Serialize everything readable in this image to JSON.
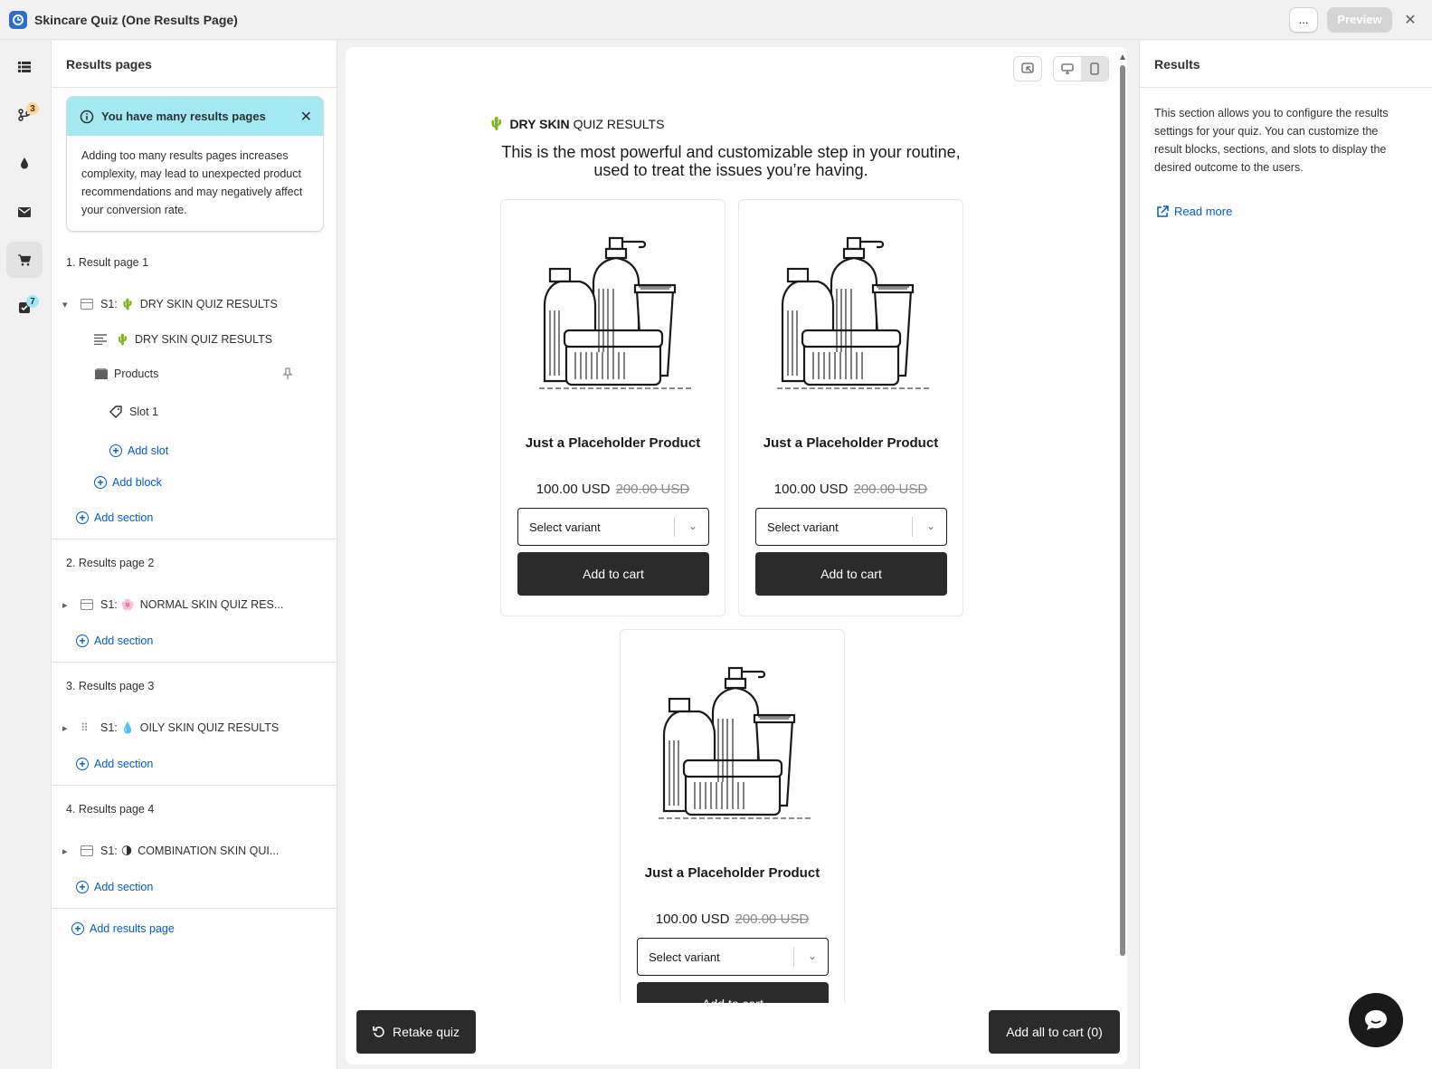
{
  "app": {
    "title": "Skincare Quiz (One Results Page)",
    "more_label": "...",
    "preview_label": "Preview"
  },
  "rail": {
    "items": [
      {
        "icon": "list-icon",
        "badge": ""
      },
      {
        "icon": "branch-icon",
        "badge": "3"
      },
      {
        "icon": "drop-icon",
        "badge": ""
      },
      {
        "icon": "mail-icon",
        "badge": ""
      },
      {
        "icon": "cart-icon",
        "badge": ""
      },
      {
        "icon": "checklist-icon",
        "badge": "7"
      }
    ]
  },
  "left": {
    "title": "Results pages",
    "banner": {
      "title": "You have many results pages",
      "body": "Adding too many results pages increases complexity, may lead to unexpected product recommendations and may negatively affect your conversion rate."
    },
    "pages": [
      {
        "heading": "1. Result page 1",
        "section_label": "S1:",
        "section_emoji": "🌵",
        "section_name": "DRY SKIN QUIZ RESULTS",
        "block_text": "DRY SKIN QUIZ RESULTS",
        "block_products": "Products",
        "slot": "Slot 1",
        "add_slot": "Add slot",
        "add_block": "Add block",
        "add_section": "Add section"
      },
      {
        "heading": "2. Results page 2",
        "section_label": "S1:",
        "section_emoji": "🌸",
        "section_name": "NORMAL SKIN QUIZ RES...",
        "add_section": "Add section"
      },
      {
        "heading": "3. Results page 3",
        "section_label": "S1:",
        "section_emoji": "💧",
        "section_name": "OILY SKIN QUIZ RESULTS",
        "add_section": "Add section"
      },
      {
        "heading": "4. Results page 4",
        "section_label": "S1:",
        "section_emoji": "🌗",
        "section_name": "COMBINATION SKIN QUI...",
        "add_section": "Add section"
      }
    ],
    "add_results_page": "Add results page"
  },
  "preview": {
    "title_emoji": "🌵",
    "title_bold": "DRY SKIN",
    "title_rest": "QUIZ RESULTS",
    "subtitle": "This is the most powerful and customizable step in your routine, used to treat the issues you’re having.",
    "products": [
      {
        "name": "Just a Placeholder Product",
        "price": "100.00 USD",
        "compare_price": "200.00 USD",
        "variant_placeholder": "Select variant",
        "cart_label": "Add to cart"
      },
      {
        "name": "Just a Placeholder Product",
        "price": "100.00 USD",
        "compare_price": "200.00 USD",
        "variant_placeholder": "Select variant",
        "cart_label": "Add to cart"
      },
      {
        "name": "Just a Placeholder Product",
        "price": "100.00 USD",
        "compare_price": "200.00 USD",
        "variant_placeholder": "Select variant",
        "cart_label": "Add to cart"
      }
    ],
    "retake_label": "Retake quiz",
    "add_all_label": "Add all to cart (0)"
  },
  "right": {
    "title": "Results",
    "body": "This section allows you to configure the results settings for your quiz. You can customize the result blocks, sections, and slots to display the desired outcome to the users.",
    "read_more": "Read more"
  },
  "colors": {
    "accent": "#005bd3",
    "banner": "#a4e8f2",
    "button_dark": "#2b2b2b"
  }
}
